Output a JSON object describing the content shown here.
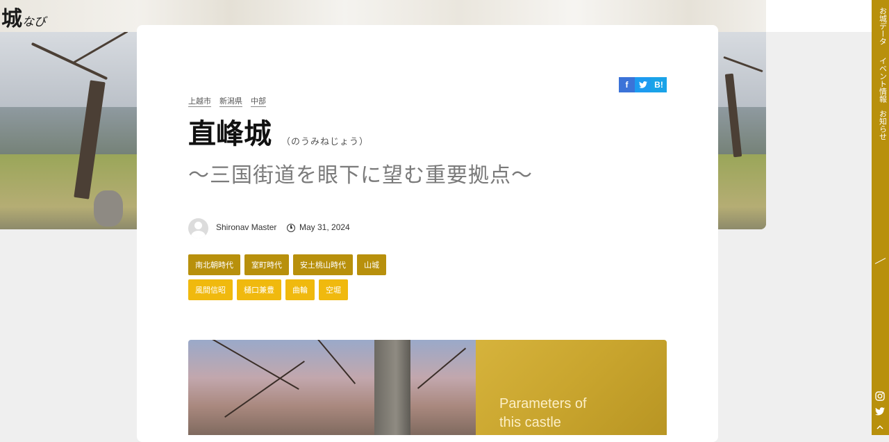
{
  "site": {
    "logo_main": "城",
    "logo_sub": "なび"
  },
  "sidenav": {
    "items": [
      {
        "label": "お城データ"
      },
      {
        "label": "イベント情報"
      },
      {
        "label": "お知らせ"
      }
    ],
    "icons": [
      "instagram-icon",
      "twitter-icon",
      "chevron-up-icon"
    ]
  },
  "share": {
    "facebook": "f",
    "twitter": "t",
    "hatena": "B!"
  },
  "breadcrumbs": [
    "上越市",
    "新潟県",
    "中部"
  ],
  "article": {
    "title": "直峰城",
    "reading": "（のうみねじょう）",
    "subtitle": "〜三国街道を眼下に望む重要拠点〜",
    "author": "Shironav Master",
    "date": "May 31, 2024"
  },
  "tags": {
    "row1": [
      "南北朝時代",
      "室町時代",
      "安土桃山時代",
      "山城"
    ],
    "row2": [
      "風間信昭",
      "樋口兼豊",
      "曲輪",
      "空堀"
    ]
  },
  "parameters": {
    "line1": "Parameters of",
    "line2": "this castle"
  },
  "colors": {
    "accent": "#b8900c",
    "accent_light": "#f0b90e",
    "facebook": "#3b73d8",
    "twitter": "#1d9bf0",
    "hatena": "#1aa3e8"
  }
}
